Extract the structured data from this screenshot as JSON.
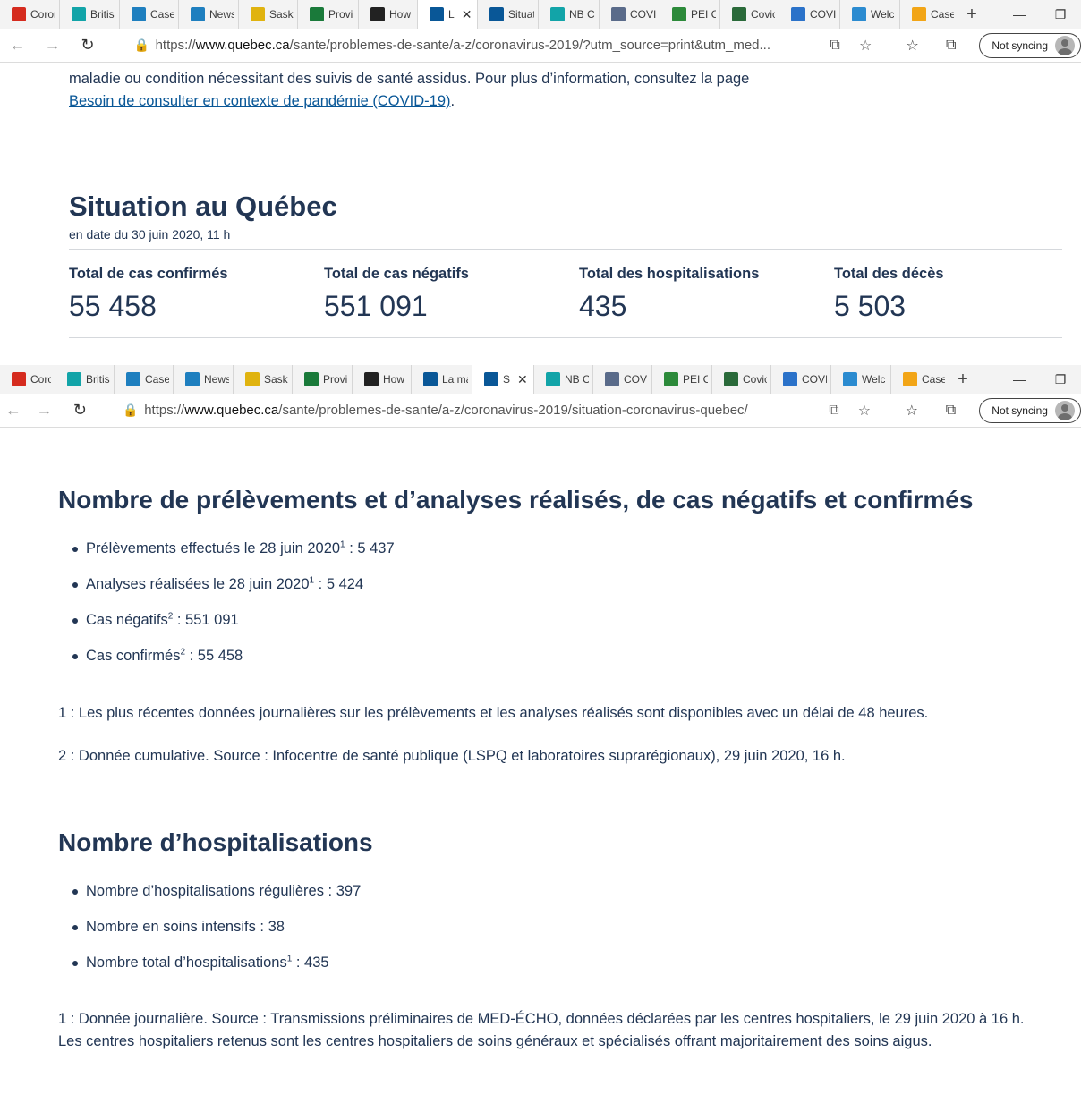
{
  "browser1": {
    "tabs": [
      {
        "label": "Coror",
        "icon": "maple-leaf-icon",
        "color": "#d52b1e"
      },
      {
        "label": "Britis",
        "icon": "bc-shield-icon",
        "color": "#12a4a8"
      },
      {
        "label": "Cases",
        "icon": "chart-icon",
        "color": "#1e7fbf"
      },
      {
        "label": "News",
        "icon": "chart-icon",
        "color": "#1e7fbf"
      },
      {
        "label": "Saska",
        "icon": "wheat-icon",
        "color": "#e0b30f"
      },
      {
        "label": "Provi",
        "icon": "manitoba-icon",
        "color": "#1a7a3a"
      },
      {
        "label": "How",
        "icon": "ontario-icon",
        "color": "#222222"
      },
      {
        "label": "L",
        "icon": "fleur-de-lis-icon",
        "color": "#095797",
        "active": true
      },
      {
        "label": "Situat",
        "icon": "fleur-de-lis-icon",
        "color": "#095797"
      },
      {
        "label": "NB C",
        "icon": "bc-shield-icon",
        "color": "#12a4a8"
      },
      {
        "label": "COVI",
        "icon": "ns-icon",
        "color": "#5a6b8a"
      },
      {
        "label": "PEI C",
        "icon": "pei-tree-icon",
        "color": "#2c8a3a"
      },
      {
        "label": "Covic",
        "icon": "globe-icon",
        "color": "#2a6a3a"
      },
      {
        "label": "COVI",
        "icon": "nl-icon",
        "color": "#2b72c9"
      },
      {
        "label": "Welc",
        "icon": "yukon-icon",
        "color": "#2b8bd0"
      },
      {
        "label": "Case",
        "icon": "nwt-icon",
        "color": "#f2a516"
      }
    ],
    "url_prefix": "https://",
    "url_host": "www.quebec.ca",
    "url_path": "/sante/problemes-de-sante/a-z/coronavirus-2019/?utm_source=print&utm_med..."
  },
  "browser2": {
    "tabs": [
      {
        "label": "Coro",
        "icon": "maple-leaf-icon",
        "color": "#d52b1e"
      },
      {
        "label": "Britis",
        "icon": "bc-shield-icon",
        "color": "#12a4a8"
      },
      {
        "label": "Case",
        "icon": "chart-icon",
        "color": "#1e7fbf"
      },
      {
        "label": "News",
        "icon": "chart-icon",
        "color": "#1e7fbf"
      },
      {
        "label": "Saska",
        "icon": "wheat-icon",
        "color": "#e0b30f"
      },
      {
        "label": "Provi",
        "icon": "manitoba-icon",
        "color": "#1a7a3a"
      },
      {
        "label": "How",
        "icon": "ontario-icon",
        "color": "#222222"
      },
      {
        "label": "La ma",
        "icon": "fleur-de-lis-icon",
        "color": "#095797"
      },
      {
        "label": "S",
        "icon": "fleur-de-lis-icon",
        "color": "#095797",
        "active": true
      },
      {
        "label": "NB C",
        "icon": "bc-shield-icon",
        "color": "#12a4a8"
      },
      {
        "label": "COVI",
        "icon": "ns-icon",
        "color": "#5a6b8a"
      },
      {
        "label": "PEI C",
        "icon": "pei-tree-icon",
        "color": "#2c8a3a"
      },
      {
        "label": "Covic",
        "icon": "globe-icon",
        "color": "#2a6a3a"
      },
      {
        "label": "COVI",
        "icon": "nl-icon",
        "color": "#2b72c9"
      },
      {
        "label": "Welc",
        "icon": "yukon-icon",
        "color": "#2b8bd0"
      },
      {
        "label": "Case",
        "icon": "nwt-icon",
        "color": "#f2a516"
      }
    ],
    "url_prefix": "https://",
    "url_host": "www.quebec.ca",
    "url_path": "/sante/problemes-de-sante/a-z/coronavirus-2019/situation-coronavirus-quebec/"
  },
  "sync_label": "Not syncing",
  "page1": {
    "intro_line": "maladie ou condition nécessitant des suivis de santé assidus. Pour plus d’information, consultez la page",
    "link_text": "Besoin de consulter en contexte de pandémie (COVID-19)",
    "link_suffix": ".",
    "title": "Situation au Québec",
    "date": "en date du 30 juin 2020, 11 h",
    "stats": [
      {
        "label": "Total de cas confirmés",
        "value": "55 458"
      },
      {
        "label": "Total de cas négatifs",
        "value": "551 091"
      },
      {
        "label": "Total des hospitalisations",
        "value": "435"
      },
      {
        "label": "Total des décès",
        "value": "5 503"
      }
    ]
  },
  "page2": {
    "section1_title": "Nombre de prélèvements et d’analyses réalisés, de cas négatifs et confirmés",
    "section1_items": [
      {
        "text": "Prélèvements effectués le 28 juin 2020",
        "sup": "1",
        "value": " : 5 437"
      },
      {
        "text": "Analyses réalisées le 28 juin 2020",
        "sup": "1",
        "value": " : 5 424"
      },
      {
        "text": "Cas négatifs",
        "sup": "2",
        "value": " : 551 091"
      },
      {
        "text": "Cas confirmés",
        "sup": "2",
        "value": " : 55 458"
      }
    ],
    "note1": "1 : Les plus récentes données journalières sur les prélèvements et les analyses réalisés sont disponibles avec un délai de 48 heures.",
    "note2": "2 : Donnée cumulative. Source : Infocentre de santé publique (LSPQ et laboratoires suprarégionaux), 29 juin 2020, 16 h.",
    "section2_title": "Nombre d’hospitalisations",
    "section2_items": [
      {
        "text": "Nombre d’hospitalisations régulières : 397",
        "sup": "",
        "value": ""
      },
      {
        "text": "Nombre en soins intensifs : 38",
        "sup": "",
        "value": ""
      },
      {
        "text": "Nombre total d’hospitalisations",
        "sup": "1",
        "value": " : 435"
      }
    ],
    "note3": "1 : Donnée journalière. Source : Transmissions préliminaires de MED-ÉCHO, données déclarées par les centres hospitaliers, le 29 juin 2020 à 16 h. Les centres hospitaliers retenus sont les centres hospitaliers de soins généraux et spécialisés offrant majoritairement des soins aigus."
  }
}
